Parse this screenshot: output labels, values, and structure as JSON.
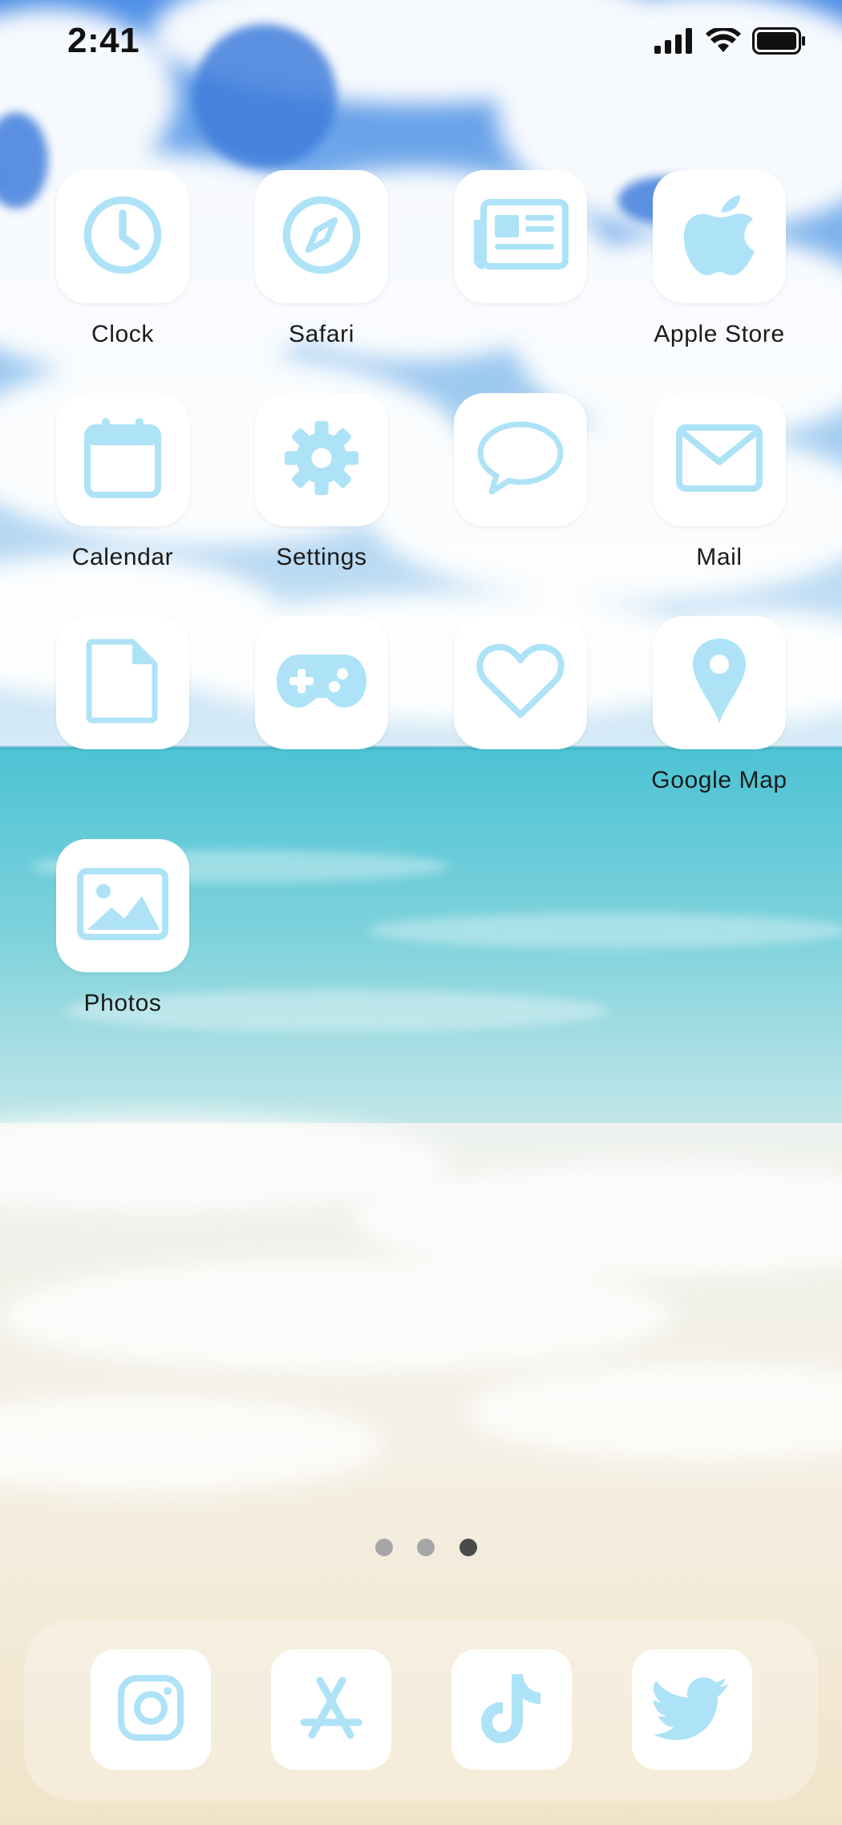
{
  "status_bar": {
    "time": "2:41",
    "signal_icon": "cellular-signal-icon",
    "wifi_icon": "wifi-icon",
    "battery_icon": "battery-icon"
  },
  "colors": {
    "icon_glyph": "#aee3f7",
    "tile_background": "#ffffff",
    "label_text": "#1a1a1a",
    "dot_inactive": "#a6a6a6",
    "dot_active": "#4a4a4a"
  },
  "apps": [
    {
      "label": "Clock",
      "icon": "clock-icon"
    },
    {
      "label": "Safari",
      "icon": "compass-icon"
    },
    {
      "label": "",
      "icon": "newspaper-icon"
    },
    {
      "label": "Apple Store",
      "icon": "apple-icon"
    },
    {
      "label": "Calendar",
      "icon": "calendar-icon"
    },
    {
      "label": "Settings",
      "icon": "gear-icon"
    },
    {
      "label": "",
      "icon": "speech-bubble-icon"
    },
    {
      "label": "Mail",
      "icon": "envelope-icon"
    },
    {
      "label": "",
      "icon": "document-icon"
    },
    {
      "label": "",
      "icon": "gamepad-icon"
    },
    {
      "label": "",
      "icon": "heart-icon"
    },
    {
      "label": "Google Map",
      "icon": "map-pin-icon"
    },
    {
      "label": "Photos",
      "icon": "photo-icon"
    }
  ],
  "page_indicator": {
    "page_count": 3,
    "current_page": 3
  },
  "dock": [
    {
      "app": "Instagram",
      "icon": "instagram-icon"
    },
    {
      "app": "App Store",
      "icon": "app-store-icon"
    },
    {
      "app": "TikTok",
      "icon": "tiktok-icon"
    },
    {
      "app": "Twitter",
      "icon": "twitter-bird-icon"
    }
  ]
}
